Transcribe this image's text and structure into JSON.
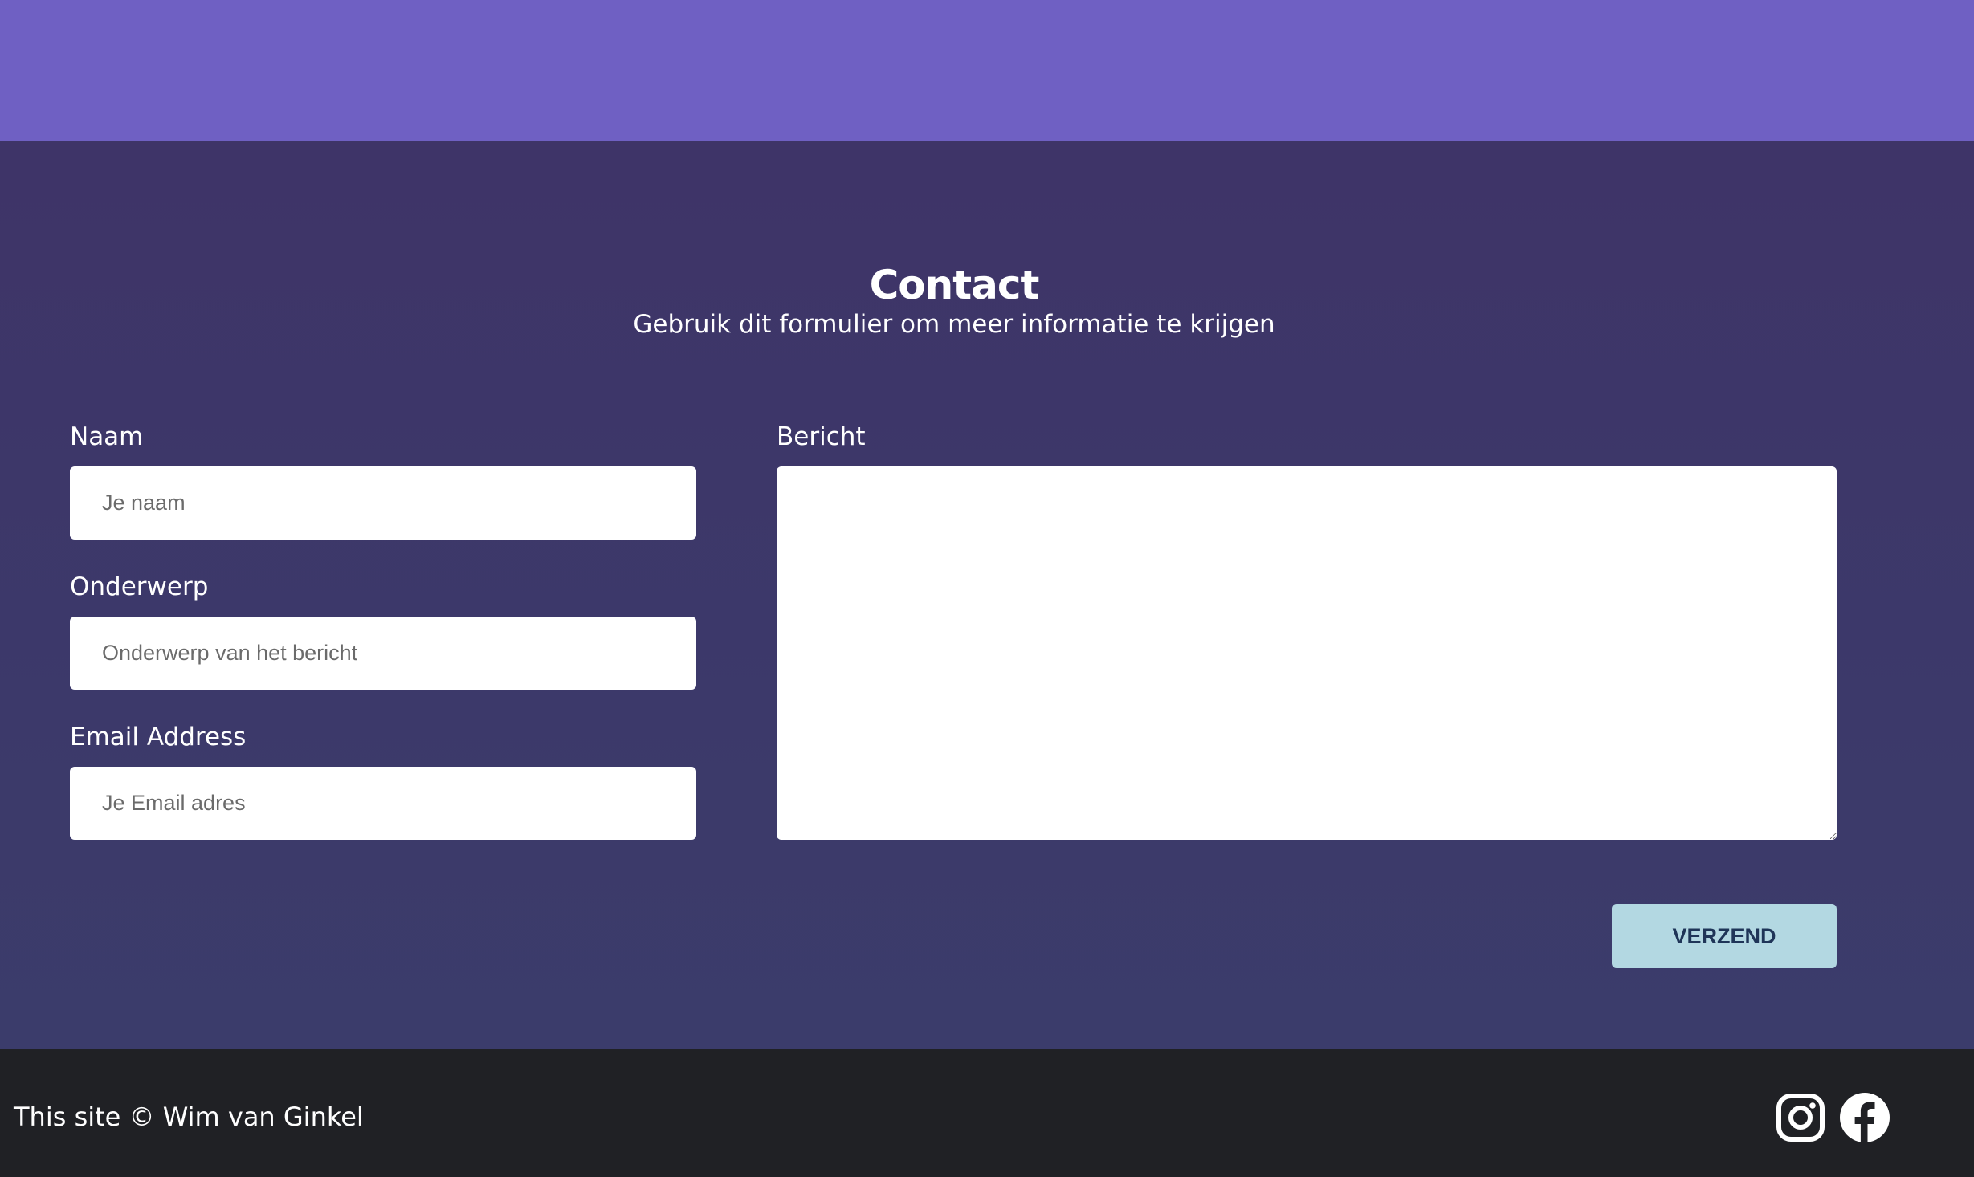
{
  "contact": {
    "title": "Contact",
    "subtitle": "Gebruik dit formulier om meer informatie te krijgen"
  },
  "form": {
    "name_label": "Naam",
    "name_placeholder": "Je naam",
    "subject_label": "Onderwerp",
    "subject_placeholder": "Onderwerp van het bericht",
    "email_label": "Email Address",
    "email_placeholder": "Je Email adres",
    "message_label": "Bericht",
    "message_value": "",
    "submit_label": "VERZEND"
  },
  "footer": {
    "copyright": "This site © Wim van Ginkel",
    "social_icons": [
      "instagram-icon",
      "facebook-icon"
    ]
  },
  "colors": {
    "top_band": "#6f60c3",
    "section_background": "#3d366a",
    "footer_background": "#202125",
    "submit_button": "#b3d8e2",
    "submit_text": "#1f3558"
  }
}
